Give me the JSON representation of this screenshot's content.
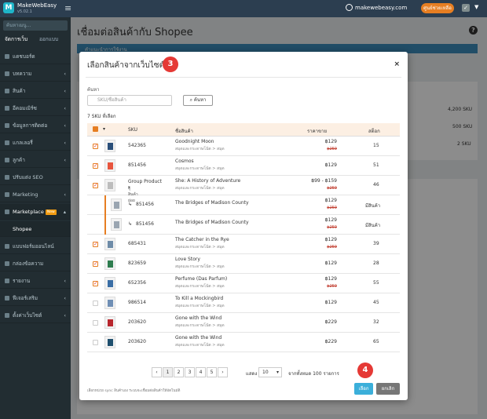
{
  "topbar": {
    "brand": "MakeWebEasy",
    "brand_sub": "v5.02.1",
    "site": "makewebeasy.com",
    "support": "ศูนย์ช่วยเหลือ"
  },
  "sidebar": {
    "search_placeholder": "ค้นหาเมนู...",
    "tab_manage": "จัดการเว็บ",
    "tab_design": "ออกแบบ",
    "items": [
      {
        "label": "แดชบอร์ด"
      },
      {
        "label": "บทความ"
      },
      {
        "label": "สินค้า"
      },
      {
        "label": "อีคอมเมิร์ซ"
      },
      {
        "label": "ข้อมูลการติดต่อ"
      },
      {
        "label": "แกลเลอรี่"
      },
      {
        "label": "ลูกค้า"
      },
      {
        "label": "ปรับแต่ง SEO"
      },
      {
        "label": "Marketing"
      },
      {
        "label": "Marketplace",
        "badge": "New"
      },
      {
        "label": "Shopee"
      },
      {
        "label": "แบบฟอร์มออนไลน์"
      },
      {
        "label": "กล่องข้อความ"
      },
      {
        "label": "รายงาน"
      },
      {
        "label": "ฟีเจอร์เสริม"
      },
      {
        "label": "ตั้งค่าเว็บไซต์"
      }
    ]
  },
  "page": {
    "title": "เชื่อมต่อสินค้ากับ Shopee",
    "bg_tip": "คำแนะนำการใช้งาน",
    "bg_sku_1": "4,200 SKU",
    "bg_sku_2": "500 SKU",
    "bg_sku_3": "2 SKU"
  },
  "modal": {
    "title": "เลือกสินค้าจากเว็บไซต์",
    "step_badge_1": "3",
    "step_badge_2": "4",
    "search_label": "ค้นหา",
    "search_placeholder": "SKU/ชื่อสินค้า",
    "search_button": "ค้นหา",
    "selected_count": "7 SKU ที่เลือก",
    "columns": {
      "sku": "SKU",
      "name": "ชื่อสินค้า",
      "price": "ราคาขาย",
      "stock": "สต็อก"
    },
    "rows": [
      {
        "checked": true,
        "sku": "542365",
        "name": "Goodnight Moon",
        "cat": "สมุดและกระดาษโน้ต > สมุด",
        "price": "฿129",
        "old": "฿259",
        "stock": "15",
        "color": "#2a4f7a"
      },
      {
        "checked": true,
        "sku": "851456",
        "name": "Cosmos",
        "cat": "สมุดและกระดาษโน้ต > สมุด",
        "price": "฿129",
        "old": "",
        "stock": "51",
        "color": "#e8553e"
      },
      {
        "checked": true,
        "sku": "Group Product",
        "sub": "ดูสินค้าย่อย",
        "name": "She: A History of Adventure",
        "cat": "สมุดและกระดาษโน้ต > สมุด",
        "price": "฿99 - ฿159",
        "old": "฿259",
        "stock": "46",
        "color": "#bdbdbd"
      },
      {
        "child": true,
        "sku": "851456",
        "name": "The Bridges of Madison County",
        "price": "฿129",
        "old": "฿259",
        "stock": "มีสินค้า",
        "color": "#9aa5b1"
      },
      {
        "child": true,
        "sku": "851456",
        "name": "The Bridges of Madison County",
        "price": "฿129",
        "old": "฿259",
        "stock": "มีสินค้า",
        "color": "#9aa5b1"
      },
      {
        "checked": true,
        "sku": "685431",
        "name": "The Catcher in the Rye",
        "cat": "สมุดและกระดาษโน้ต > สมุด",
        "price": "฿129",
        "old": "฿259",
        "stock": "39",
        "color": "#6e8ca8"
      },
      {
        "checked": true,
        "sku": "823659",
        "name": "Love Story",
        "cat": "สมุดและกระดาษโน้ต > สมุด",
        "price": "฿129",
        "old": "",
        "stock": "28",
        "color": "#2e7d4f"
      },
      {
        "checked": true,
        "sku": "652356",
        "name": "Perfume (Das Parfum)",
        "cat": "สมุดและกระดาษโน้ต > สมุด",
        "price": "฿129",
        "old": "฿259",
        "stock": "55",
        "color": "#3a6ea5"
      },
      {
        "checked": false,
        "sku": "986514",
        "name": "To Kill a Mockingbird",
        "cat": "สมุดและกระดาษโน้ต > สมุด",
        "price": "฿129",
        "old": "",
        "stock": "45",
        "color": "#6f8fb5"
      },
      {
        "checked": false,
        "sku": "203620",
        "name": "Gone with the Wind",
        "cat": "สมุดและกระดาษโน้ต > สมุด",
        "price": "฿229",
        "old": "",
        "stock": "32",
        "color": "#b8262d"
      },
      {
        "checked": false,
        "sku": "203620",
        "name": "Gone with the Wind",
        "cat": "สมุดและกระดาษโน้ต > สมุด",
        "price": "฿229",
        "old": "",
        "stock": "65",
        "color": "#1f4f6e"
      }
    ],
    "pager": {
      "prev": "‹",
      "pages": [
        "1",
        "2",
        "3",
        "4",
        "5"
      ],
      "next": "›"
    },
    "per_page_label": "แสดง",
    "per_page": "10",
    "total_label": "จากทั้งหมด 100 รายการ",
    "footnote": "เลือกหน่วย sync สินค้าเอง ระบบจะเชื่อมต่อสินค้าให้อัตโนมัติ",
    "ok": "เลือก",
    "cancel": "ยกเลิก"
  }
}
